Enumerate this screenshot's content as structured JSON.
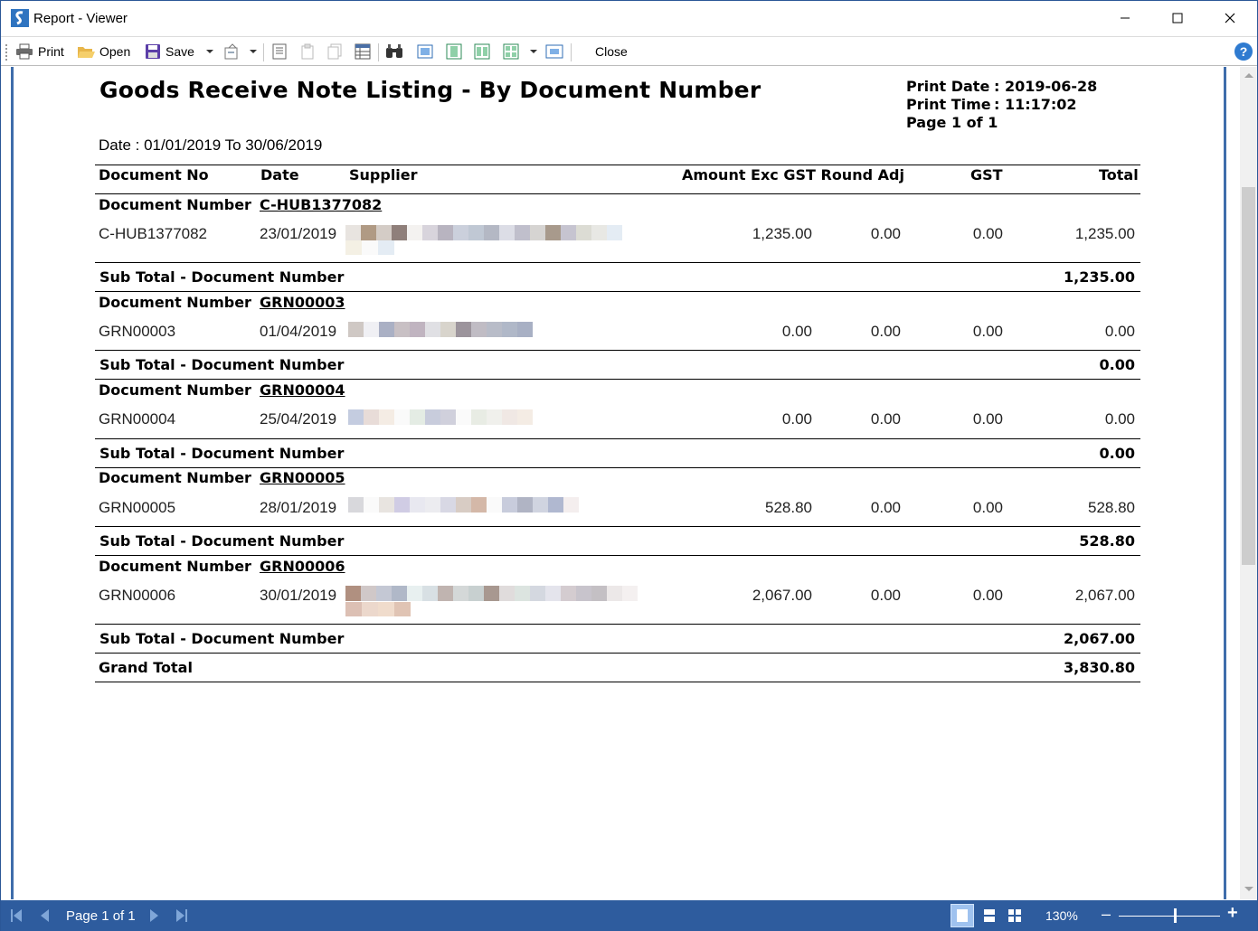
{
  "window": {
    "title": "Report - Viewer",
    "buttons": {
      "minimize": "—",
      "maximize": "☐",
      "close": "✕"
    }
  },
  "toolbar": {
    "print_label": "Print",
    "open_label": "Open",
    "save_label": "Save",
    "close_label": "Close",
    "help_label": "?"
  },
  "report": {
    "title": "Goods Receive Note Listing - By Document Number",
    "print_date_label": "Print Date",
    "print_date_value": ": 2019-06-28",
    "print_time_label": "Print Time",
    "print_time_value": ": 11:17:02",
    "page_info": "Page 1 of 1",
    "date_range": "Date : 01/01/2019 To 30/06/2019",
    "columns": {
      "doc_no": "Document No",
      "date": "Date",
      "supplier": "Supplier",
      "amount_round": "Amount Exc GST Round Adj",
      "gst": "GST",
      "total": "Total"
    },
    "group_label": "Document Number",
    "subtotal_label": "Sub Total - Document Number",
    "grand_total_label": "Grand Total",
    "grand_total_value": "3,830.80",
    "groups": [
      {
        "group_value": "C-HUB1377082",
        "doc_no": "C-HUB1377082",
        "date": "23/01/2019",
        "amount": "1,235.00",
        "round_adj": "0.00",
        "gst": "0.00",
        "total": "1,235.00",
        "subtotal": "1,235.00"
      },
      {
        "group_value": "GRN00003",
        "doc_no": "GRN00003",
        "date": "01/04/2019",
        "amount": "0.00",
        "round_adj": "0.00",
        "gst": "0.00",
        "total": "0.00",
        "subtotal": "0.00"
      },
      {
        "group_value": "GRN00004",
        "doc_no": "GRN00004",
        "date": "25/04/2019",
        "amount": "0.00",
        "round_adj": "0.00",
        "gst": "0.00",
        "total": "0.00",
        "subtotal": "0.00"
      },
      {
        "group_value": "GRN00005",
        "doc_no": "GRN00005",
        "date": "28/01/2019",
        "amount": "528.80",
        "round_adj": "0.00",
        "gst": "0.00",
        "total": "528.80",
        "subtotal": "528.80"
      },
      {
        "group_value": "GRN00006",
        "doc_no": "GRN00006",
        "date": "30/01/2019",
        "amount": "2,067.00",
        "round_adj": "0.00",
        "gst": "0.00",
        "total": "2,067.00",
        "subtotal": "2,067.00"
      }
    ]
  },
  "statusbar": {
    "page_indicator": "Page 1 of 1",
    "zoom": "130%"
  },
  "colors": {
    "accent_blue": "#2e5c9e",
    "page_border": "#3f6dab"
  }
}
